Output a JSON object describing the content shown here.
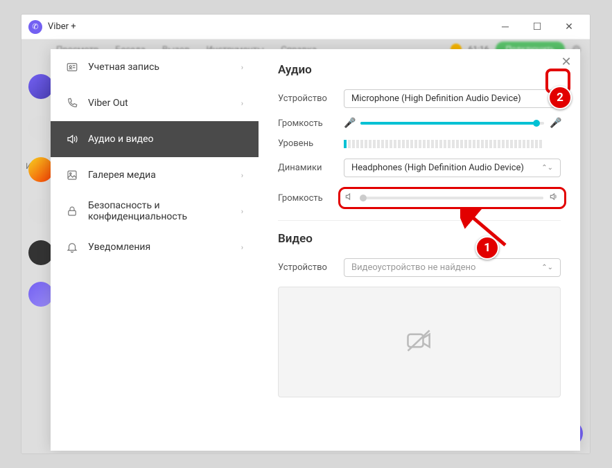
{
  "window": {
    "title": "Viber +"
  },
  "bgmenu": {
    "items": [
      "Просмотр",
      "Беседа",
      "Вызов",
      "Инструменты",
      "Справка"
    ],
    "balance": "61:16",
    "buy": "Подключить"
  },
  "sidebar": {
    "items": [
      {
        "label": "Учетная запись"
      },
      {
        "label": "Viber Out"
      },
      {
        "label": "Аудио и видео"
      },
      {
        "label": "Галерея медиа"
      },
      {
        "label": "Безопасность и конфиденциальность"
      },
      {
        "label": "Уведомления"
      }
    ],
    "side_label": "Из"
  },
  "audio": {
    "header": "Аудио",
    "device_label": "Устройство",
    "device_value": "Microphone (High Definition Audio Device)",
    "volume_label": "Громкость",
    "level_label": "Уровень",
    "speakers_label": "Динамики",
    "speakers_value": "Headphones (High Definition Audio Device)",
    "sp_volume_label": "Громкость"
  },
  "video": {
    "header": "Видео",
    "device_label": "Устройство",
    "device_value": "Видеоустройство не найдено"
  },
  "markers": {
    "one": "1",
    "two": "2"
  },
  "colors": {
    "accent": "#00c1d4",
    "highlight": "#e20000",
    "brand": "#7360f2"
  }
}
